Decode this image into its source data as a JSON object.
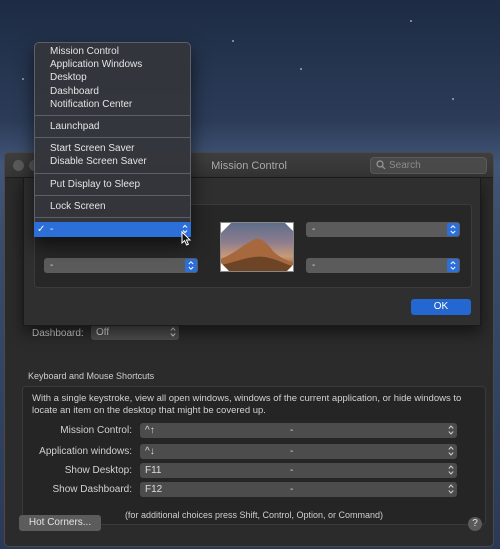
{
  "window": {
    "title": "Mission Control"
  },
  "search": {
    "placeholder": "Search"
  },
  "context_menu": {
    "groups": [
      [
        "Mission Control",
        "Application Windows",
        "Desktop",
        "Dashboard",
        "Notification Center"
      ],
      [
        "Launchpad"
      ],
      [
        "Start Screen Saver",
        "Disable Screen Saver"
      ],
      [
        "Put Display to Sleep"
      ],
      [
        "Lock Screen"
      ]
    ],
    "selected": "-"
  },
  "hot_corners": {
    "top_left": "-",
    "top_right": "-",
    "bottom_left": "-",
    "bottom_right": "-",
    "ok_label": "OK"
  },
  "behind": {
    "dashboard_label": "Dashboard:",
    "dashboard_value": "Off"
  },
  "shortcuts": {
    "section_title": "Keyboard and Mouse Shortcuts",
    "description": "With a single keystroke, view all open windows, windows of the current application, or hide windows to locate an item on the desktop that might be covered up.",
    "rows": [
      {
        "label": "Mission Control:",
        "key": "^↑",
        "mouse": "-"
      },
      {
        "label": "Application windows:",
        "key": "^↓",
        "mouse": "-"
      },
      {
        "label": "Show Desktop:",
        "key": "F11",
        "mouse": "-"
      },
      {
        "label": "Show Dashboard:",
        "key": "F12",
        "mouse": "-"
      }
    ],
    "footnote": "(for additional choices press Shift, Control, Option, or Command)"
  },
  "buttons": {
    "hot_corners": "Hot Corners...",
    "help": "?"
  },
  "colors": {
    "accent": "#2d6fd9",
    "ok": "#2567d1"
  }
}
